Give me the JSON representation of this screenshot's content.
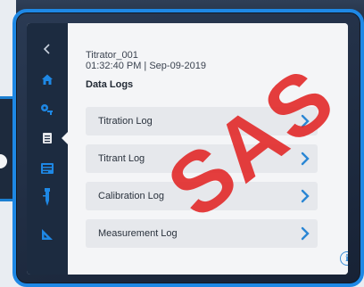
{
  "header": {
    "device_name": "Titrator_001",
    "timestamp": "01:32:40 PM | Sep-09-2019"
  },
  "section": {
    "title": "Data Logs"
  },
  "logs": [
    {
      "label": "Titration Log",
      "icon": "chevron-right-icon"
    },
    {
      "label": "Titrant Log",
      "icon": "chevron-right-icon"
    },
    {
      "label": "Calibration Log",
      "icon": "chevron-right-icon"
    },
    {
      "label": "Measurement Log",
      "icon": "chevron-right-icon"
    }
  ],
  "sidebar": {
    "items": [
      {
        "icon": "back-arrow-icon"
      },
      {
        "icon": "home-icon"
      },
      {
        "icon": "settings-key-icon"
      },
      {
        "icon": "data-logs-icon",
        "active": true
      },
      {
        "icon": "display-icon"
      },
      {
        "icon": "electrode-icon"
      },
      {
        "icon": "ruler-triangle-icon"
      }
    ]
  },
  "info": {
    "icon": "info-icon",
    "glyph": "i"
  },
  "watermark": {
    "text": "SAS"
  },
  "colors": {
    "accent": "#3a8fd8",
    "frame": "#1e88e5",
    "sidebar": "#1c2b40",
    "watermark": "#e12323"
  }
}
